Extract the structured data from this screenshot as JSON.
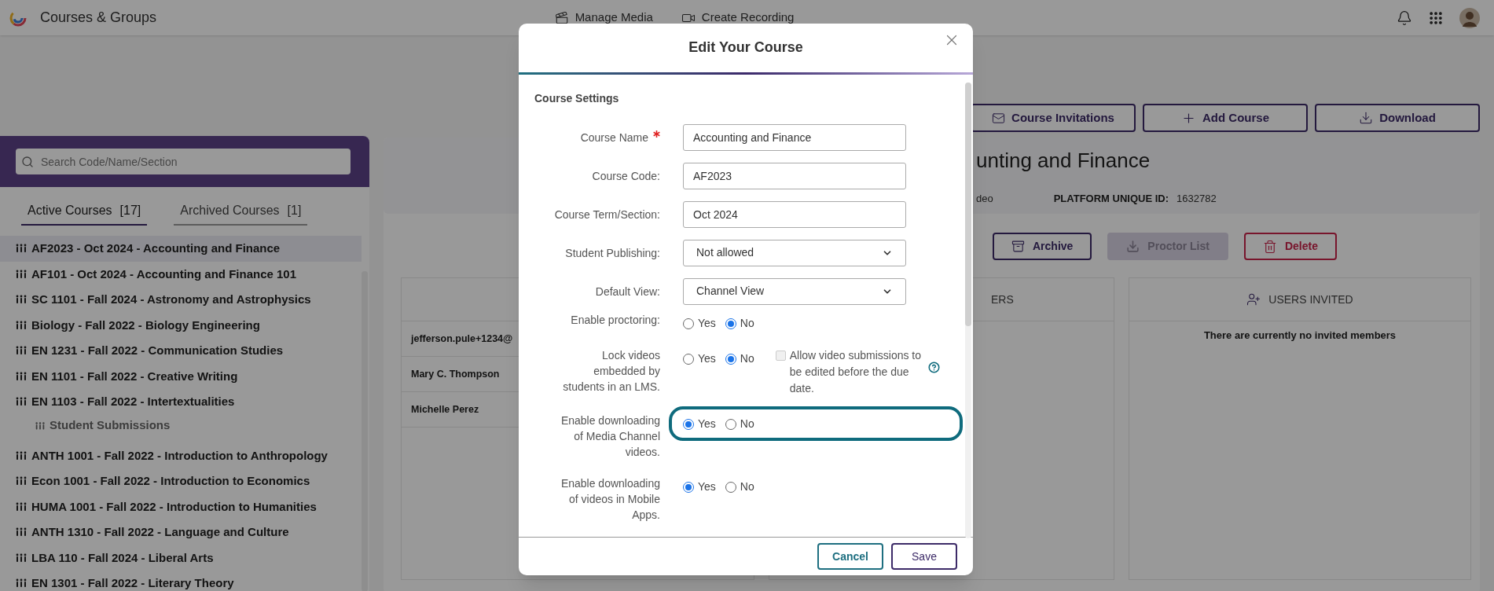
{
  "top_bar": {
    "title": "Courses & Groups",
    "nav": [
      {
        "label": "Manage Media",
        "kind": "media"
      },
      {
        "label": "Create Recording",
        "kind": "recording"
      }
    ]
  },
  "toolbar": [
    {
      "label": "Course Invitations",
      "kind": "mail"
    },
    {
      "label": "Add Course",
      "kind": "plus"
    },
    {
      "label": "Download",
      "kind": "download"
    }
  ],
  "sidebar": {
    "search": {
      "placeholder": "Search Code/Name/Section"
    },
    "tabs": [
      {
        "label": "Active Courses",
        "count": "[17]",
        "selected": true
      },
      {
        "label": "Archived Courses",
        "count": "[1]",
        "selected": false
      }
    ],
    "courses": [
      {
        "label": "AF2023 - Oct 2024 - Accounting and Finance",
        "selected": true
      },
      {
        "label": "AF101 - Oct 2024 - Accounting and Finance 101",
        "selected": false
      },
      {
        "label": "SC 1101 - Fall 2024 - Astronomy and Astrophysics",
        "selected": false
      },
      {
        "label": "Biology - Fall 2022 - Biology Engineering",
        "selected": false
      },
      {
        "label": "EN 1231 - Fall 2022 - Communication Studies",
        "selected": false
      },
      {
        "label": "EN 1101 - Fall 2022 - Creative Writing",
        "selected": false
      },
      {
        "label": "EN 1103 - Fall 2022 - Intertextualities",
        "selected": false,
        "children": [
          {
            "label": "Student Submissions",
            "selected": false
          }
        ]
      },
      {
        "label": "ANTH 1001 - Fall 2022 - Introduction to Anthropology",
        "selected": false
      },
      {
        "label": "Econ 1001 - Fall 2022 - Introduction to Economics",
        "selected": false
      },
      {
        "label": "HUMA 1001 - Fall 2022 - Introduction to Humanities",
        "selected": false
      },
      {
        "label": "ANTH 1310 - Fall 2022 - Language and Culture",
        "selected": false
      },
      {
        "label": "LBA 110 - Fall 2024 - Liberal Arts",
        "selected": false
      },
      {
        "label": "EN 1301 - Fall 2022 - Literary Theory",
        "selected": false
      }
    ]
  },
  "course_panel": {
    "title": "unting and Finance",
    "info_1": "deo",
    "platform_id_label": "PLATFORM UNIQUE ID:",
    "platform_id": "1632782",
    "actions": [
      {
        "label": "Archive",
        "kind": "archive",
        "disabled": false
      },
      {
        "label": "Proctor List",
        "kind": "proctor",
        "disabled": true
      },
      {
        "label": "Delete",
        "kind": "delete",
        "disabled": false
      }
    ],
    "members": [
      "jefferson.pule+1234@",
      "Mary C. Thompson",
      "Michelle Perez"
    ],
    "column_2_header": "ERS",
    "invited": {
      "header": "USERS INVITED",
      "empty": "There are currently no invited members"
    }
  },
  "modal": {
    "title": "Edit Your Course",
    "section": "Course Settings",
    "rows": [
      {
        "kind": "text",
        "label": "Course Name",
        "required": true,
        "value": "Accounting and Finance"
      },
      {
        "kind": "text",
        "label": "Course Code:",
        "required": false,
        "value": "AF2023"
      },
      {
        "kind": "text",
        "label": "Course Term/Section:",
        "required": false,
        "value": "Oct 2024"
      },
      {
        "kind": "select",
        "label": "Student Publishing:",
        "required": false,
        "value": "Not allowed"
      },
      {
        "kind": "select",
        "label": "Default View:",
        "required": false,
        "value": "Channel View"
      },
      {
        "kind": "radio",
        "label": "Enable proctoring:",
        "highlighted": false,
        "options": [
          {
            "label": "Yes",
            "selected": false
          },
          {
            "label": "No",
            "selected": true
          }
        ]
      },
      {
        "kind": "radio",
        "label": "Lock videos embedded by students in an LMS.",
        "highlighted": false,
        "options": [
          {
            "label": "Yes",
            "selected": false
          },
          {
            "label": "No",
            "selected": true
          }
        ],
        "extra": {
          "label": "Allow video submissions to be edited before the due date.",
          "checked": false,
          "disabled": true
        }
      },
      {
        "kind": "radio",
        "label": "Enable downloading of Media Channel videos.",
        "highlighted": true,
        "options": [
          {
            "label": "Yes",
            "selected": true
          },
          {
            "label": "No",
            "selected": false
          }
        ]
      },
      {
        "kind": "radio",
        "label": "Enable downloading of videos in Mobile Apps.",
        "highlighted": false,
        "options": [
          {
            "label": "Yes",
            "selected": true
          },
          {
            "label": "No",
            "selected": false
          }
        ]
      }
    ],
    "buttons": [
      {
        "label": "Cancel",
        "kind": "cancel"
      },
      {
        "label": "Save",
        "kind": "save"
      }
    ]
  }
}
